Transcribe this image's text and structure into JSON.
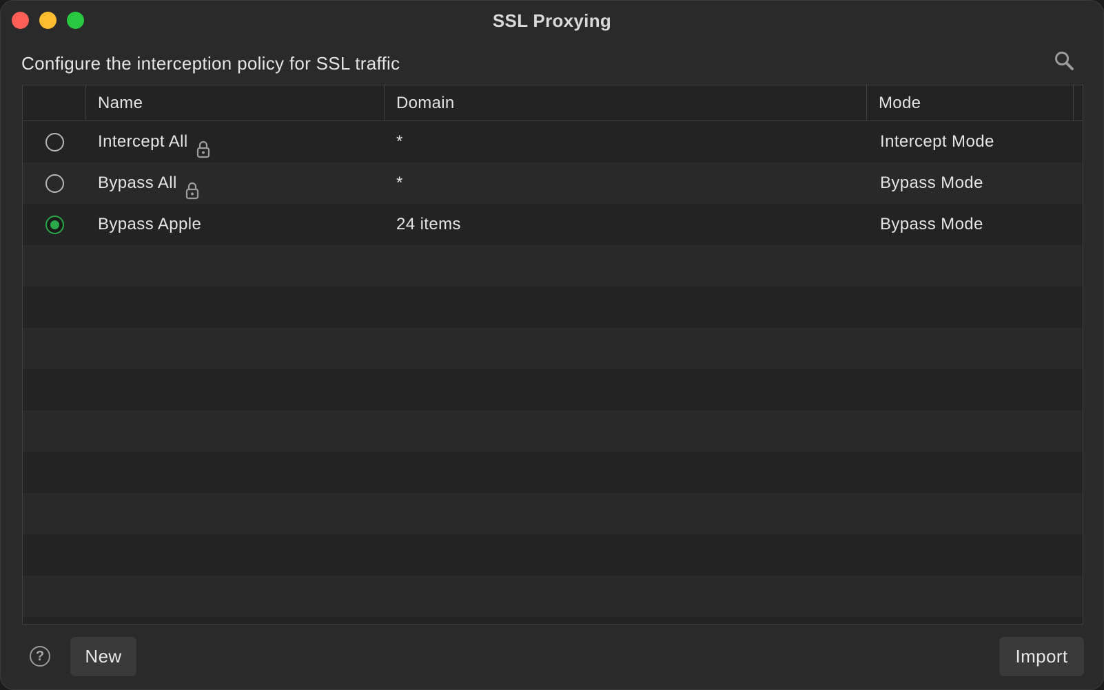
{
  "window": {
    "title": "SSL Proxying"
  },
  "header": {
    "subtitle": "Configure the interception policy for SSL traffic",
    "search_icon": "search-icon"
  },
  "table": {
    "columns": [
      "",
      "Name",
      "Domain",
      "Mode"
    ],
    "rows": [
      {
        "selected": false,
        "name": "Intercept All",
        "locked": true,
        "domain": "*",
        "mode": "Intercept Mode"
      },
      {
        "selected": false,
        "name": "Bypass All",
        "locked": true,
        "domain": "*",
        "mode": "Bypass Mode"
      },
      {
        "selected": true,
        "name": "Bypass Apple",
        "locked": false,
        "domain": "24 items",
        "mode": "Bypass Mode"
      }
    ]
  },
  "footer": {
    "help_icon": "help-icon",
    "help_glyph": "?",
    "new_label": "New",
    "import_label": "Import"
  },
  "colors": {
    "accent_green": "#2aa84a",
    "close": "#ff5f57",
    "minimize": "#febc2e",
    "maximize": "#28c840"
  }
}
